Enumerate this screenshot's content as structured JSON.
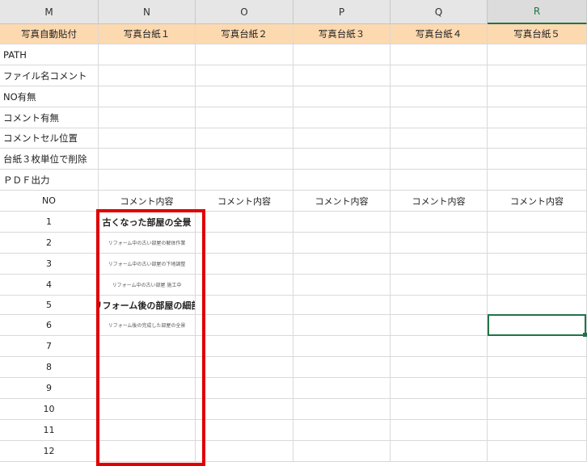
{
  "columns": [
    "M",
    "N",
    "O",
    "P",
    "Q",
    "R"
  ],
  "header_row": [
    "写真自動貼付",
    "写真台紙１",
    "写真台紙２",
    "写真台紙３",
    "写真台紙４",
    "写真台紙５"
  ],
  "settings_labels": [
    "PATH",
    "ファイル名コメント",
    "NO有無",
    "コメント有無",
    "コメントセル位置",
    "台紙３枚単位で削除",
    "ＰＤＦ出力"
  ],
  "no_header": "NO",
  "comment_header": "コメント内容",
  "row_numbers": [
    "1",
    "2",
    "3",
    "4",
    "5",
    "6",
    "7",
    "8",
    "9",
    "10",
    "11",
    "12"
  ],
  "comments": [
    {
      "text": "古くなった部屋の全景",
      "style": "big"
    },
    {
      "text": "リフォーム中の古い部屋の解体作業",
      "style": "small"
    },
    {
      "text": "リフォーム中の古い部屋の下地調整",
      "style": "small"
    },
    {
      "text": "リフォーム中の古い部屋 施工中",
      "style": "small"
    },
    {
      "text": "リフォーム後の部屋の細部",
      "style": "big"
    },
    {
      "text": "リフォーム後の完成した部屋の全景",
      "style": "small"
    }
  ],
  "colors": {
    "header_fill": "#fdd9b0",
    "highlight_border": "#e00000",
    "selection": "#217346"
  }
}
